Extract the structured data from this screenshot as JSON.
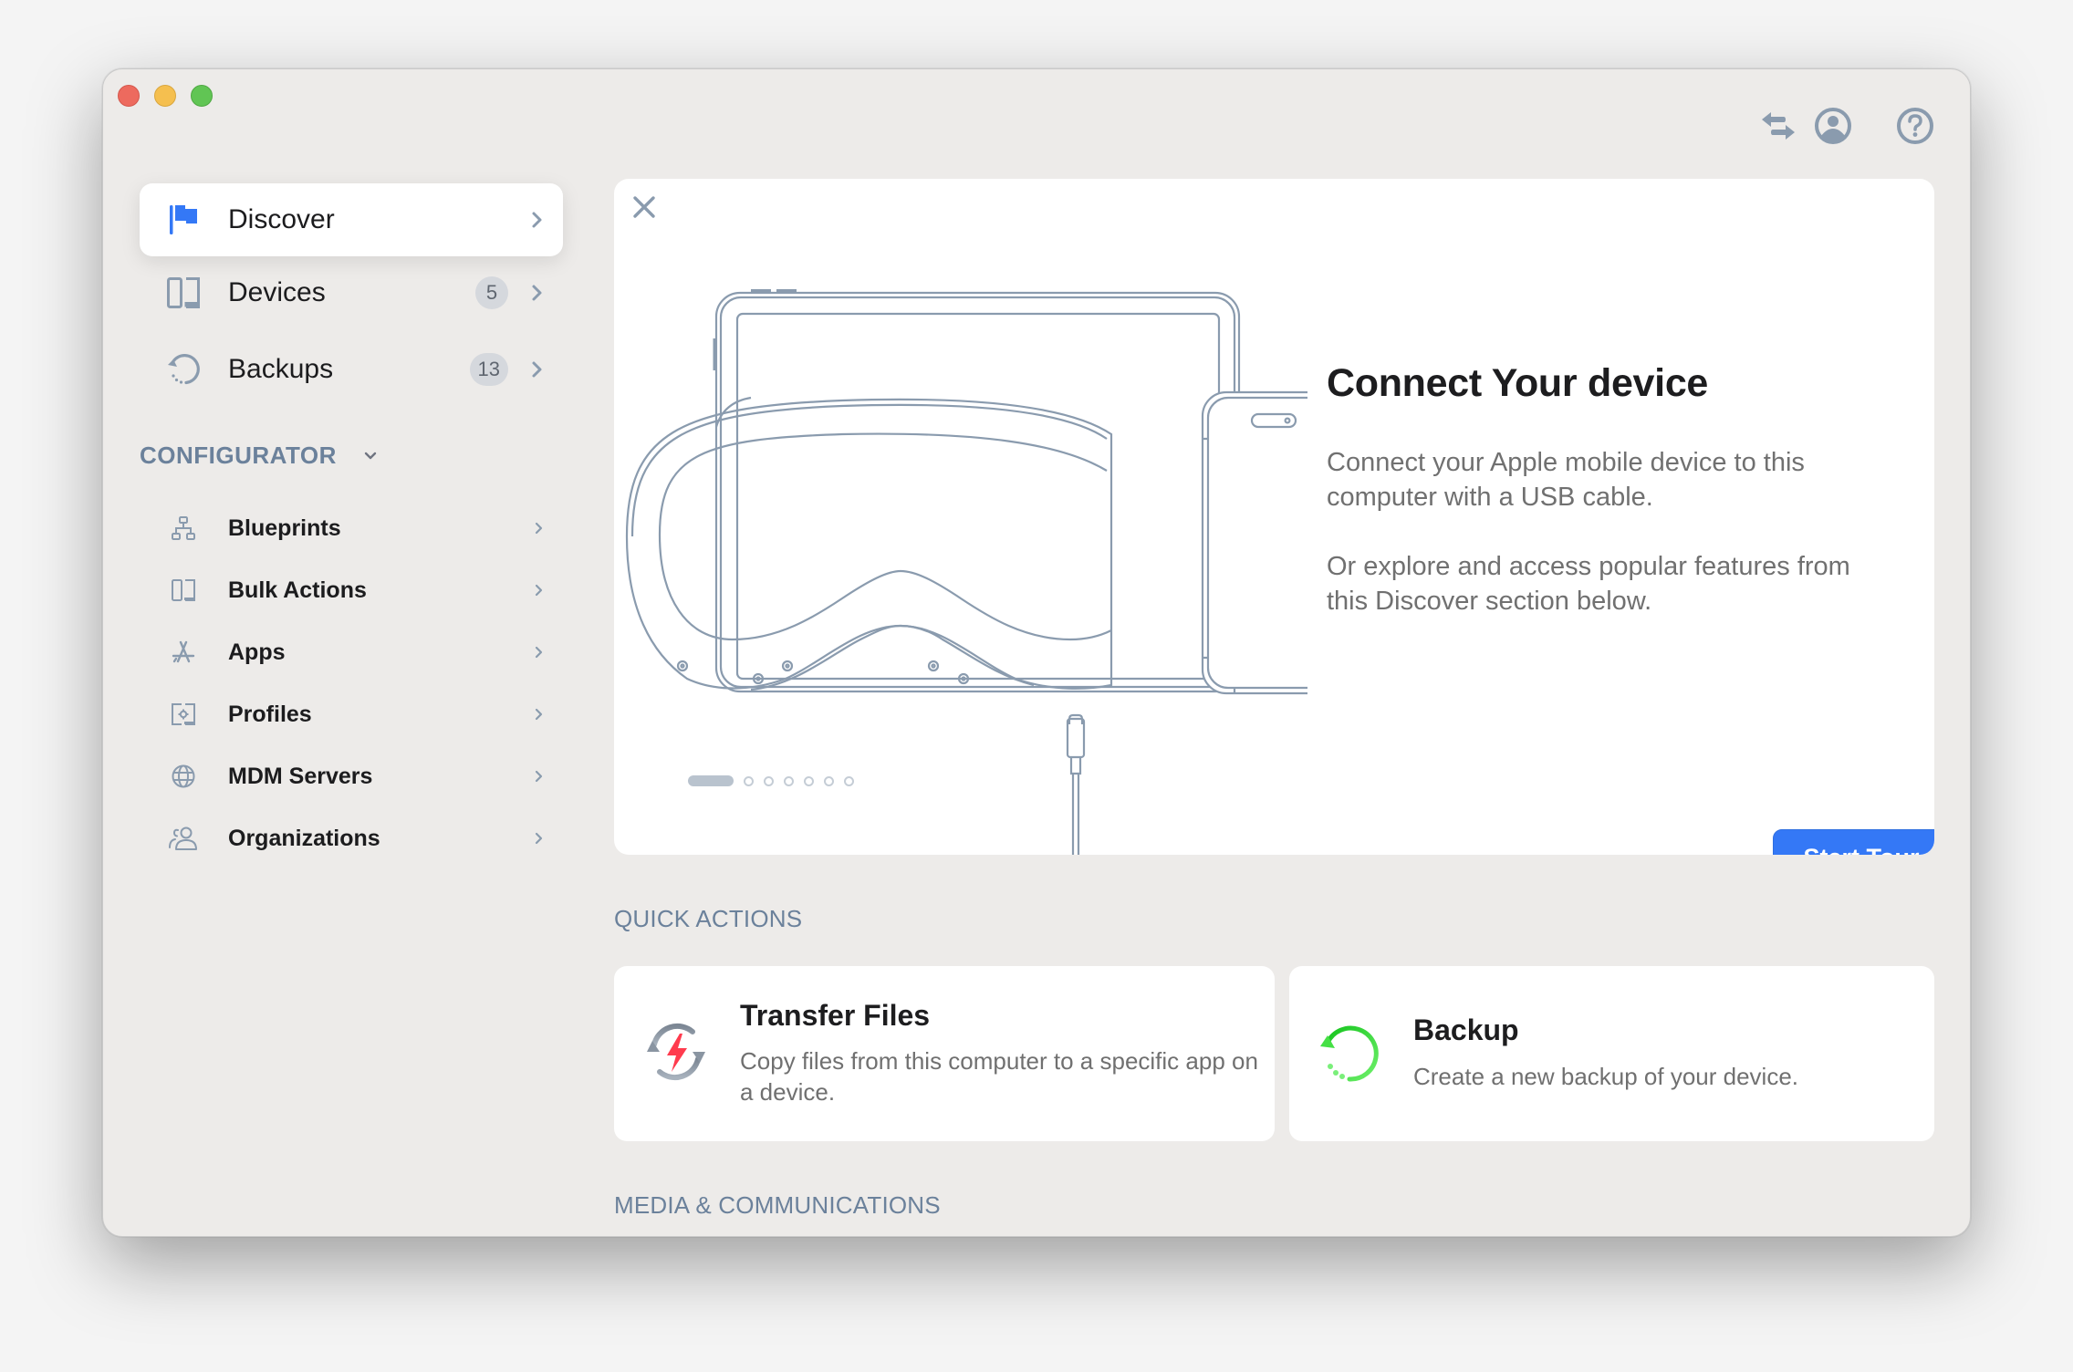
{
  "window": {
    "traffic_lights": [
      "close",
      "minimize",
      "maximize"
    ],
    "toolbar_icons": [
      {
        "name": "transfer-arrows-icon"
      },
      {
        "name": "account-icon"
      },
      {
        "name": "help-icon"
      }
    ]
  },
  "sidebar": {
    "main_items": [
      {
        "label": "Discover",
        "icon": "flag-icon",
        "badge": null,
        "active": true
      },
      {
        "label": "Devices",
        "icon": "devices-icon",
        "badge": "5",
        "active": false
      },
      {
        "label": "Backups",
        "icon": "backup-icon",
        "badge": "13",
        "active": false
      }
    ],
    "section_header": "CONFIGURATOR",
    "configurator_items": [
      {
        "label": "Blueprints",
        "icon": "blueprints-icon"
      },
      {
        "label": "Bulk Actions",
        "icon": "bulk-actions-icon"
      },
      {
        "label": "Apps",
        "icon": "app-store-icon"
      },
      {
        "label": "Profiles",
        "icon": "profiles-icon"
      },
      {
        "label": "MDM Servers",
        "icon": "globe-icon"
      },
      {
        "label": "Organizations",
        "icon": "people-icon"
      }
    ]
  },
  "hero": {
    "title": "Connect Your device",
    "paragraph1": "Connect your Apple mobile device to this computer with a USB cable.",
    "paragraph2": "Or explore and access popular features from this Discover section below.",
    "button_label": "Start Tour",
    "pager": {
      "total": 7,
      "current": 1
    }
  },
  "quick_actions": {
    "header": "QUICK ACTIONS",
    "cards": [
      {
        "title": "Transfer Files",
        "description": "Copy files from this computer to a specific app on a device.",
        "icon": "transfer-files-icon"
      },
      {
        "title": "Backup",
        "description": "Create a new backup of your device.",
        "icon": "backup-green-icon"
      }
    ]
  },
  "media_section": {
    "header": "MEDIA & COMMUNICATIONS"
  },
  "colors": {
    "accent": "#3478F6",
    "icon_gray": "#8A9BAE",
    "section_header": "#6B819B",
    "window_bg": "#EDEBE9",
    "backup_green": "#2BD92B",
    "transfer_red": "#FF3B4E"
  }
}
